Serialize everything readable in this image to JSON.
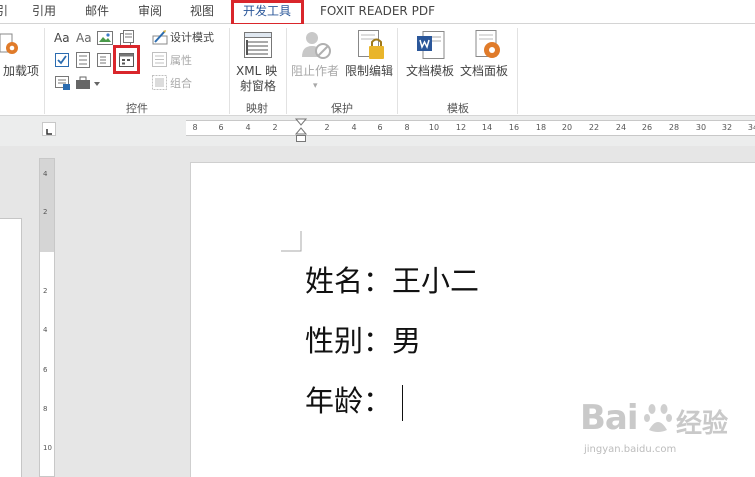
{
  "tabs": [
    {
      "label": "引",
      "active": false
    },
    {
      "label": "引用",
      "active": false
    },
    {
      "label": "邮件",
      "active": false
    },
    {
      "label": "审阅",
      "active": false
    },
    {
      "label": "视图",
      "active": false
    },
    {
      "label": "开发工具",
      "active": true
    },
    {
      "label": "FOXIT READER PDF",
      "active": false
    }
  ],
  "ribbon": {
    "addins": {
      "label": "加载项"
    },
    "controls": {
      "group_label": "控件",
      "aa_rich": "Aa",
      "aa_plain": "Aa",
      "design_mode": "设计模式",
      "properties": "属性",
      "group": "组合"
    },
    "mapping": {
      "group_label": "映射",
      "xml_line1": "XML 映",
      "xml_line2": "射窗格"
    },
    "protect": {
      "group_label": "保护",
      "block_authors": "阻止作者",
      "restrict_editing": "限制编辑"
    },
    "templates": {
      "group_label": "模板",
      "document_template": "文档模板",
      "document_panel": "文档面板"
    }
  },
  "ruler": {
    "h_ticks": [
      "8",
      "6",
      "4",
      "2",
      "2",
      "4",
      "6",
      "8",
      "10",
      "12",
      "14",
      "16",
      "18",
      "20",
      "22",
      "24",
      "26",
      "28",
      "30",
      "32",
      "34"
    ],
    "v_ticks": [
      "4",
      "2",
      "2",
      "4",
      "6",
      "8",
      "10"
    ]
  },
  "document": {
    "lines": [
      {
        "label": "姓名：",
        "value": "王小二"
      },
      {
        "label": "性别：",
        "value": "男"
      },
      {
        "label": "年龄：",
        "value": ""
      }
    ]
  },
  "watermark": {
    "brand": "Bai",
    "brand2": "经验",
    "url": "jingyan.baidu.com"
  },
  "colors": {
    "highlight_red": "#d9262b",
    "active_tab": "#2b579a",
    "word_blue": "#2b579a",
    "gear_orange": "#e07b2a"
  }
}
